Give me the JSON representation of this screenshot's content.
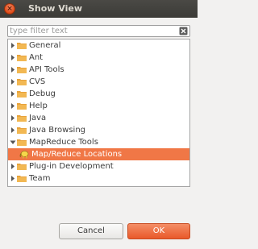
{
  "window": {
    "title": "Show View",
    "close_symbol": "×"
  },
  "filter": {
    "value": "",
    "placeholder": "type filter text",
    "clear_icon": "clear-icon"
  },
  "tree": {
    "items": [
      {
        "label": "General",
        "expanded": false
      },
      {
        "label": "Ant",
        "expanded": false
      },
      {
        "label": "API Tools",
        "expanded": false
      },
      {
        "label": "CVS",
        "expanded": false
      },
      {
        "label": "Debug",
        "expanded": false
      },
      {
        "label": "Help",
        "expanded": false
      },
      {
        "label": "Java",
        "expanded": false
      },
      {
        "label": "Java Browsing",
        "expanded": false
      },
      {
        "label": "MapReduce Tools",
        "expanded": true
      },
      {
        "label": "Map/Reduce Locations",
        "child": true,
        "selected": true
      },
      {
        "label": "Plug-in Development",
        "expanded": false
      },
      {
        "label": "Team",
        "expanded": false
      }
    ]
  },
  "buttons": {
    "cancel": "Cancel",
    "ok": "OK"
  },
  "colors": {
    "accent": "#f07746",
    "folder": "#e8a33c",
    "titlebar": "#3c3b37"
  }
}
